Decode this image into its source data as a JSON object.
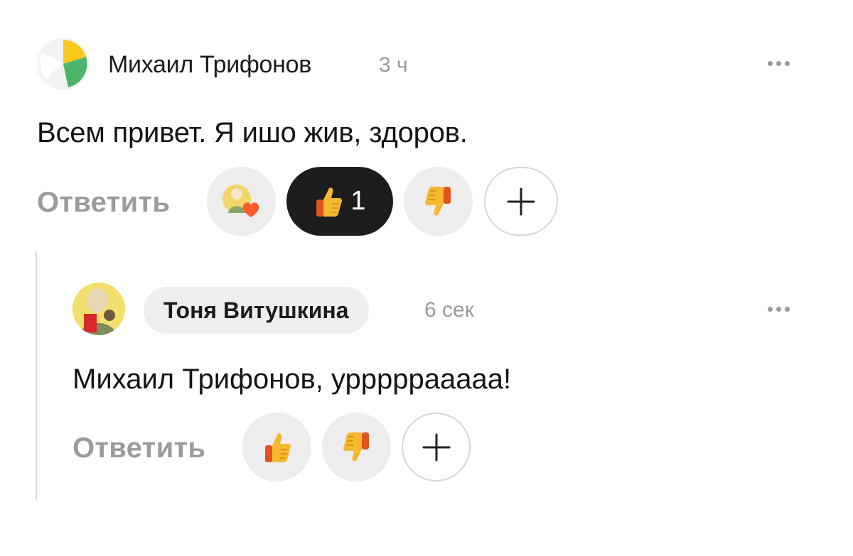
{
  "main_comment": {
    "author": "Михаил Трифонов",
    "time": "3 ч",
    "text": "Всем привет. Я ишо жив, здоров.",
    "reply_label": "Ответить",
    "reactions": {
      "like_count": "1",
      "like_active": true
    }
  },
  "reply_comment": {
    "author": "Тоня Витушкина",
    "time": "6 сек",
    "text": "Михаил Трифонов, урррррааааа!",
    "reply_label": "Ответить"
  },
  "colors": {
    "thumb_yellow": "#f5b82e",
    "heart": "#ff5a2c",
    "active_reaction_bg": "#1d1d1d"
  }
}
